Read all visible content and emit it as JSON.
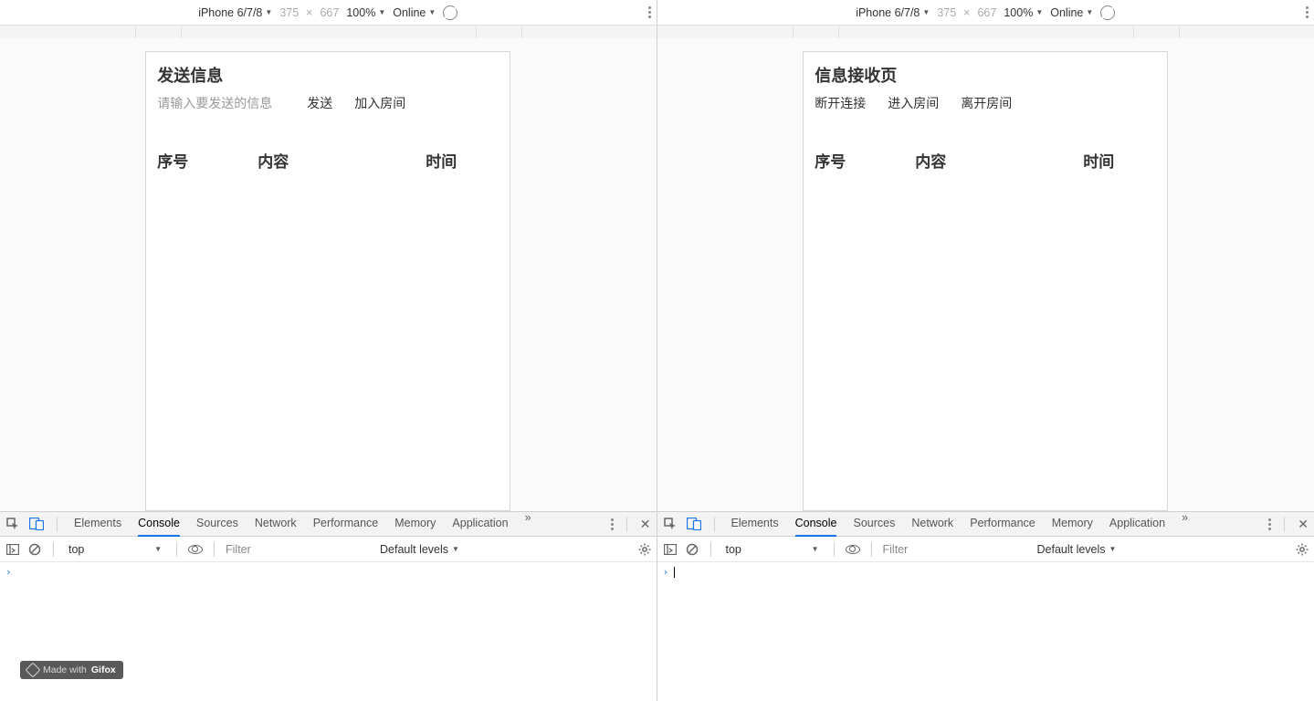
{
  "left": {
    "device_bar": {
      "device": "iPhone 6/7/8",
      "w": "375",
      "x": "×",
      "h": "667",
      "zoom": "100%",
      "throttle": "Online"
    },
    "app": {
      "title": "发送信息",
      "input_placeholder": "请输入要发送的信息",
      "btn_send": "发送",
      "btn_join": "加入房间",
      "col1": "序号",
      "col2": "内容",
      "col3": "时间"
    },
    "devtools": {
      "tabs": [
        "Elements",
        "Console",
        "Sources",
        "Network",
        "Performance",
        "Memory",
        "Application"
      ],
      "active_tab": "Console",
      "context": "top",
      "filter_placeholder": "Filter",
      "levels": "Default levels"
    }
  },
  "right": {
    "device_bar": {
      "device": "iPhone 6/7/8",
      "w": "375",
      "x": "×",
      "h": "667",
      "zoom": "100%",
      "throttle": "Online"
    },
    "app": {
      "title": "信息接收页",
      "btn_disconnect": "断开连接",
      "btn_enter": "进入房间",
      "btn_leave": "离开房间",
      "col1": "序号",
      "col2": "内容",
      "col3": "时间"
    },
    "devtools": {
      "tabs": [
        "Elements",
        "Console",
        "Sources",
        "Network",
        "Performance",
        "Memory",
        "Application"
      ],
      "active_tab": "Console",
      "context": "top",
      "filter_placeholder": "Filter",
      "levels": "Default levels"
    }
  },
  "watermark": {
    "prefix": "Made with",
    "brand": "Gifox"
  }
}
